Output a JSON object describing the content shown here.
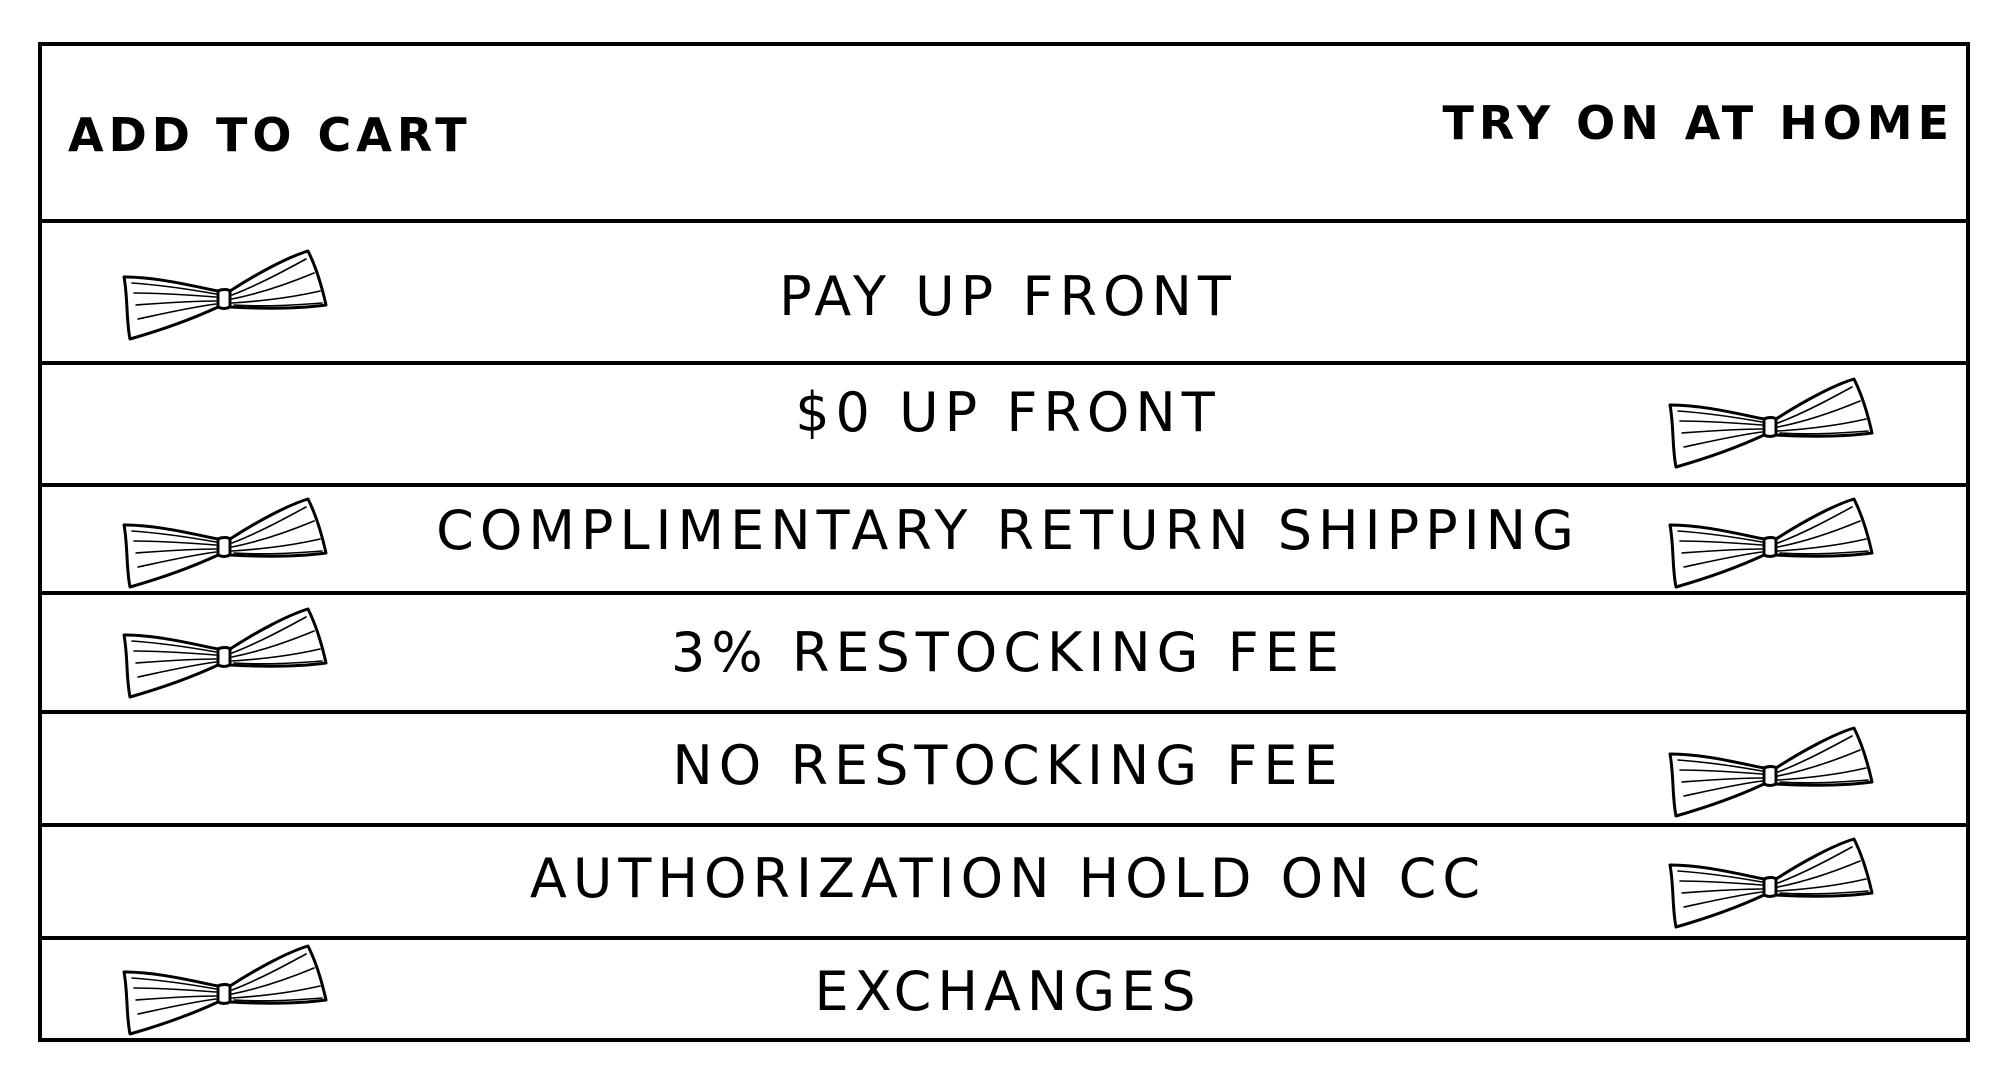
{
  "header": {
    "left_column": "ADD TO CART",
    "right_column": "TRY ON AT HOME"
  },
  "rows": [
    {
      "label": "PAY UP FRONT",
      "add_to_cart": true,
      "try_on_at_home": false
    },
    {
      "label": "$0 UP FRONT",
      "add_to_cart": false,
      "try_on_at_home": true
    },
    {
      "label": "COMPLIMENTARY RETURN SHIPPING",
      "add_to_cart": true,
      "try_on_at_home": true
    },
    {
      "label": "3% RESTOCKING FEE",
      "add_to_cart": true,
      "try_on_at_home": false
    },
    {
      "label": "NO RESTOCKING FEE",
      "add_to_cart": false,
      "try_on_at_home": true
    },
    {
      "label": "AUTHORIZATION HOLD ON CC",
      "add_to_cart": false,
      "try_on_at_home": true
    },
    {
      "label": "EXCHANGES",
      "add_to_cart": true,
      "try_on_at_home": false
    }
  ],
  "icons": {
    "check_mark": "bow-tie-icon"
  }
}
